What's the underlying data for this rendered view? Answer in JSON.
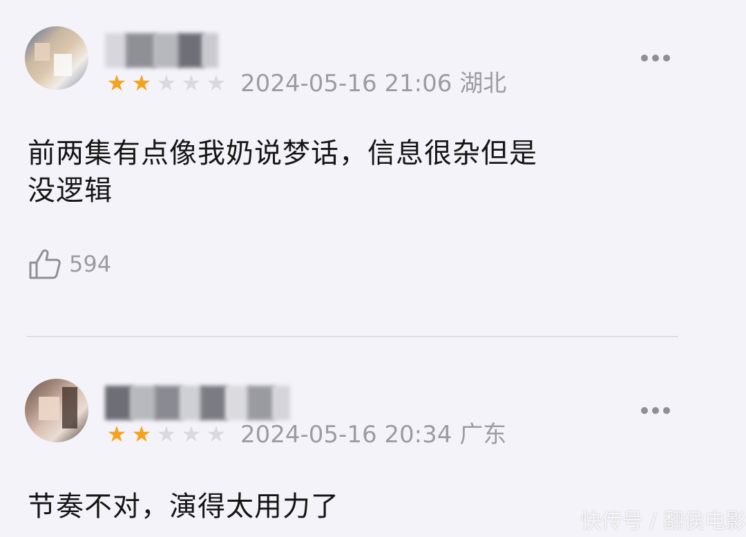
{
  "reviews": [
    {
      "username": "",
      "stars_filled": 2,
      "stars_total": 5,
      "date": "2024-05-16 21:06",
      "location": "湖北",
      "content_lines": [
        "前两集有点像我奶说梦话，信息很杂但是",
        "没逻辑"
      ],
      "like_count": "594"
    },
    {
      "username": "",
      "stars_filled": 2,
      "stars_total": 5,
      "date": "2024-05-16 20:34",
      "location": "广东",
      "content_lines": [
        "节奏不对，演得太用力了"
      ]
    }
  ],
  "icons": {
    "star": "★",
    "more": "more-icon",
    "like": "thumbs-up-icon"
  },
  "colors": {
    "star_filled": "#f5a21d",
    "star_empty": "#d9d9de",
    "meta_text": "#9b9ba3",
    "background": "#f4f3f9"
  },
  "watermark": "快传号 / 翻侯电影"
}
